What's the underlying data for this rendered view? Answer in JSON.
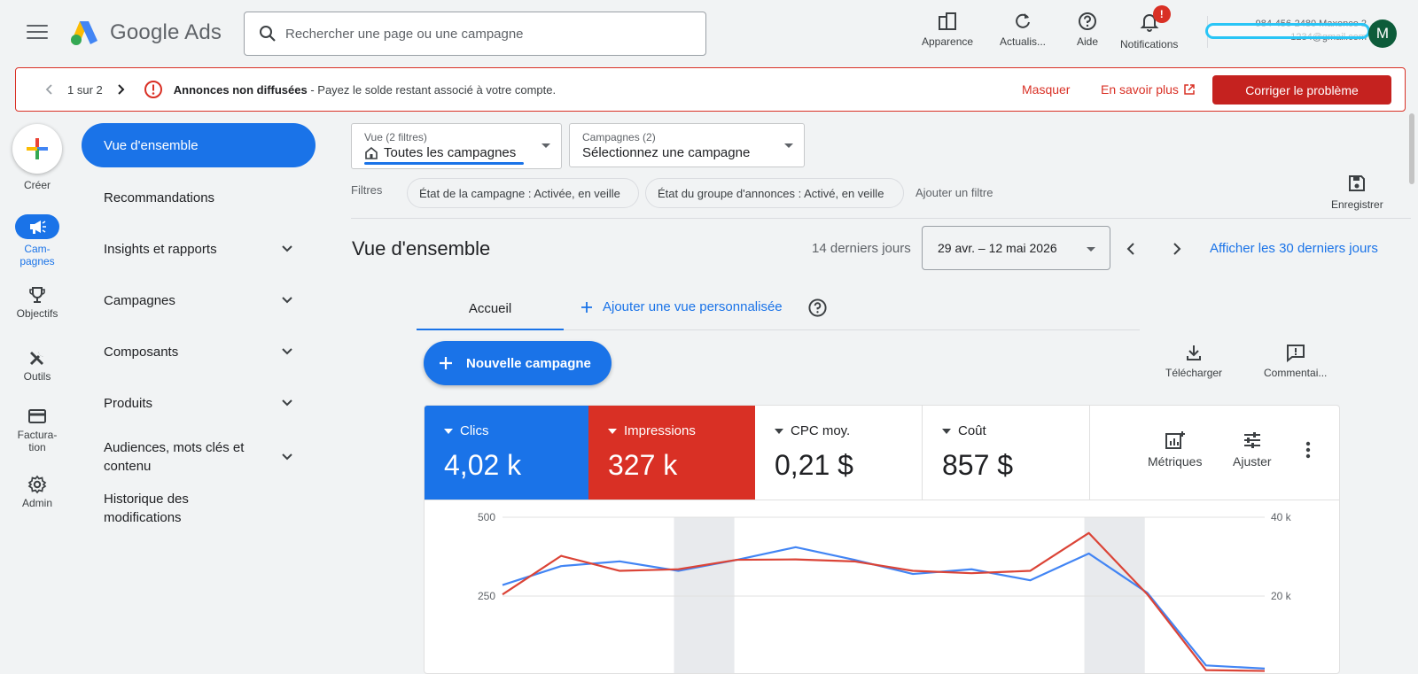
{
  "app": {
    "logo_text": "Google Ads",
    "search_placeholder": "Rechercher une page ou une campagne"
  },
  "top_actions": {
    "appearance": "Apparence",
    "refresh": "Actualis...",
    "help": "Aide",
    "notifications": "Notifications",
    "notifications_badge": "!"
  },
  "account": {
    "line1": "984-456-2480 Maxence 2",
    "line2": "1234@gmail.com",
    "avatar_letter": "M"
  },
  "banner": {
    "pager": "1 sur 2",
    "title": "Annonces non diffusées",
    "message": " - Payez le solde restant associé à votre compte.",
    "hide": "Masquer",
    "learn_more": "En savoir plus",
    "fix": "Corriger le problème"
  },
  "rail": {
    "create": "Créer",
    "campaigns": "Cam-\npagnes",
    "goals": "Objectifs",
    "tools": "Outils",
    "billing": "Factura-\ntion",
    "admin": "Admin"
  },
  "sidebar": {
    "items": [
      {
        "label": "Vue d'ensemble"
      },
      {
        "label": "Recommandations"
      },
      {
        "label": "Insights et rapports"
      },
      {
        "label": "Campagnes"
      },
      {
        "label": "Composants"
      },
      {
        "label": "Produits"
      },
      {
        "label": "Audiences, mots clés et contenu"
      },
      {
        "label": "Historique des modifications"
      }
    ]
  },
  "filters": {
    "view_small": "Vue (2 filtres)",
    "view_value": "Toutes les campagnes",
    "campaigns_small": "Campagnes (2)",
    "campaigns_value": "Sélectionnez une campagne",
    "label": "Filtres",
    "chip1": "État de la campagne : Activée, en veille",
    "chip2": "État du groupe d'annonces : Activé, en veille",
    "add_filter": "Ajouter un filtre",
    "save": "Enregistrer"
  },
  "overview": {
    "title": "Vue d'ensemble",
    "period_label": "14 derniers jours",
    "date_range": "29 avr. – 12 mai 2026",
    "show_30": "Afficher les 30 derniers jours",
    "tab_home": "Accueil",
    "add_view": "Ajouter une vue personnalisée",
    "new_campaign": "Nouvelle campagne",
    "download": "Télécharger",
    "comment": "Commentai..."
  },
  "metrics": [
    {
      "label": "Clics",
      "value": "4,02 k",
      "color": "#1a73e8"
    },
    {
      "label": "Impressions",
      "value": "327 k",
      "color": "#d93025"
    },
    {
      "label": "CPC moy.",
      "value": "0,21 $"
    },
    {
      "label": "Coût",
      "value": "857 $"
    }
  ],
  "card_tools": {
    "metrics": "Métriques",
    "adjust": "Ajuster"
  },
  "chart_data": {
    "type": "line",
    "x": [
      1,
      2,
      3,
      4,
      5,
      6,
      7,
      8,
      9,
      10,
      11,
      12,
      13,
      14
    ],
    "y_left_ticks": [
      "500",
      "250"
    ],
    "y_right_ticks": [
      "40 k",
      "20 k"
    ],
    "ylim_left": [
      0,
      500
    ],
    "ylim_right": [
      0,
      40000
    ],
    "series": [
      {
        "name": "Clics",
        "axis": "left",
        "color": "#4285f4",
        "values": [
          285,
          345,
          360,
          330,
          365,
          405,
          365,
          320,
          335,
          300,
          385,
          260,
          30,
          20
        ]
      },
      {
        "name": "Impressions",
        "axis": "right",
        "color": "#db4437",
        "values": [
          20400,
          30200,
          26400,
          26800,
          29200,
          29300,
          28800,
          26400,
          25800,
          26400,
          36000,
          20400,
          1200,
          1000
        ]
      }
    ],
    "shaded_x": [
      4,
      11
    ]
  }
}
